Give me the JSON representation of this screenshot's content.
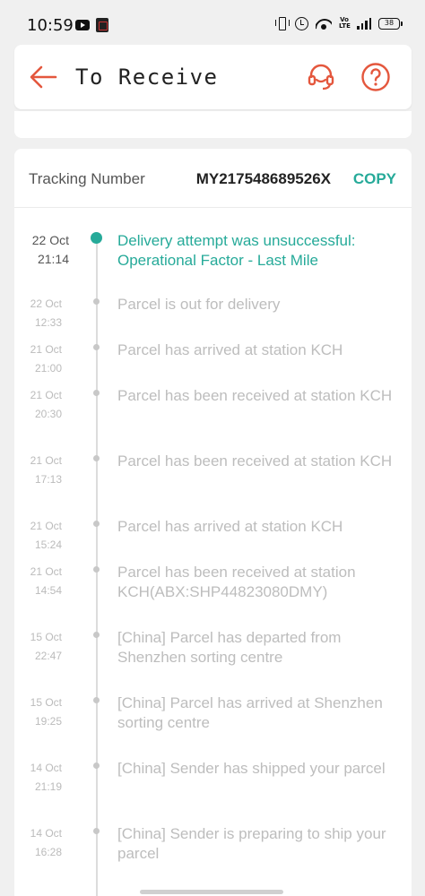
{
  "status_bar": {
    "time": "10:59",
    "battery": "38",
    "volte": "Vo LTE"
  },
  "header": {
    "title": "To Receive",
    "back_icon": "arrow-left-icon",
    "support_icon": "headset-icon",
    "help_icon": "question-circle-icon",
    "accent_color": "#e4573d"
  },
  "tracking": {
    "label": "Tracking Number",
    "number": "MY217548689526X",
    "copy_label": "COPY",
    "accent_color": "#26aa99",
    "events": [
      {
        "date": "22 Oct",
        "time": "21:14",
        "desc": "Delivery attempt was unsuccessful: Operational Factor - Last Mile",
        "active": true
      },
      {
        "date": "22 Oct",
        "time": "12:33",
        "desc": "Parcel is out for delivery"
      },
      {
        "date": "21 Oct",
        "time": "21:00",
        "desc": "Parcel has arrived at station KCH"
      },
      {
        "date": "21 Oct",
        "time": "20:30",
        "desc": "Parcel has been received at station KCH"
      },
      {
        "date": "21 Oct",
        "time": "17:13",
        "desc": "Parcel has been received at station KCH"
      },
      {
        "date": "21 Oct",
        "time": "15:24",
        "desc": "Parcel has arrived at station KCH"
      },
      {
        "date": "21 Oct",
        "time": "14:54",
        "desc": "Parcel has been received at station KCH(ABX:SHP44823080DMY)"
      },
      {
        "date": "15 Oct",
        "time": "22:47",
        "desc": "[China] Parcel has departed from Shenzhen sorting centre"
      },
      {
        "date": "15 Oct",
        "time": "19:25",
        "desc": "[China] Parcel has arrived at Shenzhen sorting centre"
      },
      {
        "date": "14 Oct",
        "time": "21:19",
        "desc": "[China] Sender has shipped your parcel"
      },
      {
        "date": "14 Oct",
        "time": "16:28",
        "desc": "[China] Sender is preparing to ship your parcel"
      }
    ]
  }
}
